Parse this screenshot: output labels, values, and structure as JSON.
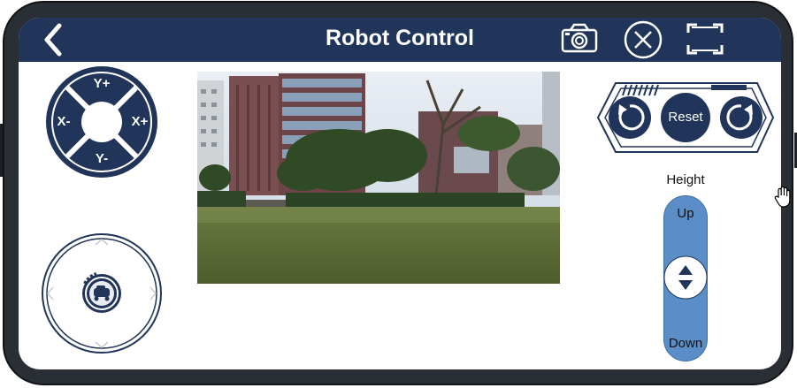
{
  "header": {
    "title": "Robot Control",
    "back_icon": "chevron-left-icon",
    "camera_icon": "camera-icon",
    "close_icon": "close-circle-icon",
    "fullscreen_icon": "fullscreen-icon"
  },
  "dpad": {
    "up": "Y+",
    "down": "Y-",
    "left": "X-",
    "right": "X+"
  },
  "joystick": {
    "icon": "robot-icon"
  },
  "video": {
    "description_icon": "camera-feed"
  },
  "rotation": {
    "reset_label": "Reset",
    "rotate_left_icon": "rotate-counterclockwise-icon",
    "rotate_right_icon": "rotate-clockwise-icon"
  },
  "height": {
    "label": "Height",
    "up_label": "Up",
    "down_label": "Down"
  },
  "colors": {
    "primary": "#213459",
    "slider": "#5b8dc6",
    "frame": "#2a2e35"
  }
}
